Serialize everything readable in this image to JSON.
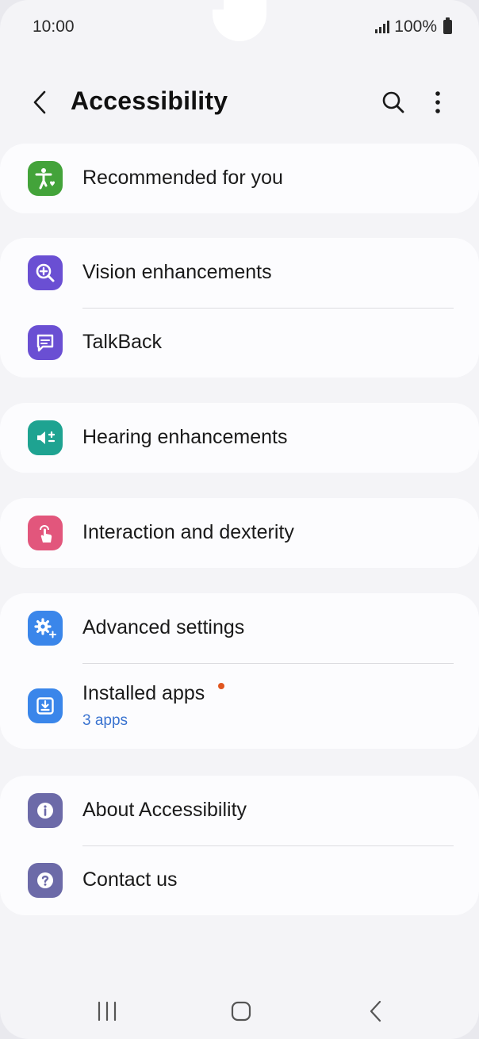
{
  "status": {
    "time": "10:00",
    "battery": "100%"
  },
  "header": {
    "title": "Accessibility"
  },
  "groups": [
    {
      "items": [
        {
          "label": "Recommended for you",
          "icon": "accessibility-person-icon",
          "color": "#43a33a"
        }
      ]
    },
    {
      "items": [
        {
          "label": "Vision enhancements",
          "icon": "magnify-plus-icon",
          "color": "#6a4fd3"
        },
        {
          "label": "TalkBack",
          "icon": "chat-bubble-icon",
          "color": "#6a4fd3"
        }
      ]
    },
    {
      "items": [
        {
          "label": "Hearing enhancements",
          "icon": "volume-plus-icon",
          "color": "#1ea391"
        }
      ]
    },
    {
      "items": [
        {
          "label": "Interaction and dexterity",
          "icon": "touch-hand-icon",
          "color": "#e2567c"
        }
      ]
    },
    {
      "items": [
        {
          "label": "Advanced settings",
          "icon": "gear-plus-icon",
          "color": "#3a86ea"
        },
        {
          "label": "Installed apps",
          "sublabel": "3 apps",
          "icon": "download-box-icon",
          "color": "#3a86ea",
          "has_new_badge": true
        }
      ]
    },
    {
      "items": [
        {
          "label": "About Accessibility",
          "icon": "info-icon",
          "color": "#6c6aa8"
        },
        {
          "label": "Contact us",
          "icon": "question-icon",
          "color": "#6c6aa8"
        }
      ]
    }
  ],
  "navbar": {
    "items": [
      "recents",
      "home",
      "back"
    ]
  }
}
